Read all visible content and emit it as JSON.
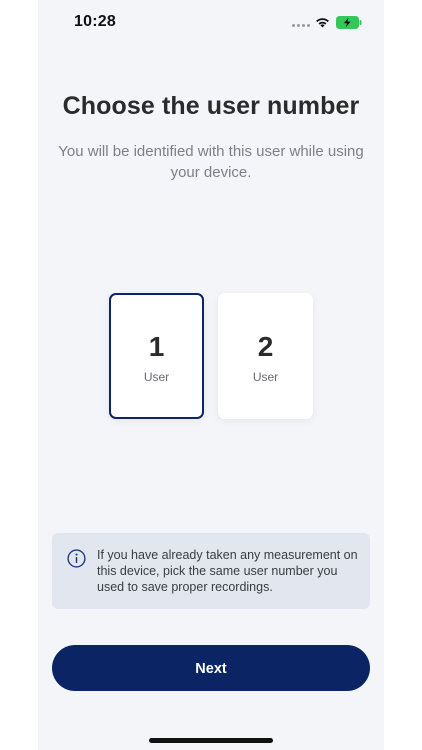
{
  "status_bar": {
    "time": "10:28",
    "battery_state": "charging",
    "battery_color": "#34c759"
  },
  "header": {
    "title": "Choose the user number",
    "subtitle": "You will be identified with this user while using your device."
  },
  "user_options": [
    {
      "number": "1",
      "label": "User",
      "selected": true
    },
    {
      "number": "2",
      "label": "User",
      "selected": false
    }
  ],
  "info": {
    "icon": "info-circle-icon",
    "text": "If you have already taken any measurement on this device, pick the same user number you used to save proper recordings."
  },
  "actions": {
    "next_label": "Next"
  },
  "colors": {
    "primary": "#0b2463",
    "background": "#f4f5f9",
    "info_background": "#e2e7ef"
  }
}
